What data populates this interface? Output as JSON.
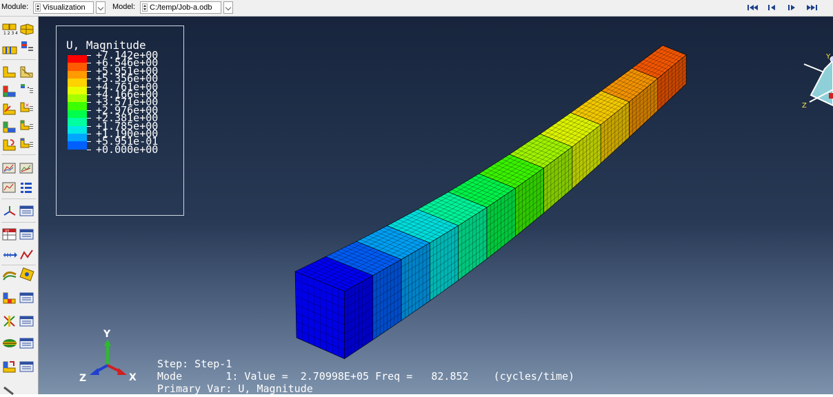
{
  "toolbar": {
    "module_label": "Module:",
    "module_value": "Visualization",
    "model_label": "Model:",
    "model_value": "C:/temp/Job-a.odb",
    "nav_icons": [
      "first-frame-icon",
      "previous-frame-icon",
      "next-frame-icon",
      "last-frame-icon"
    ]
  },
  "toolbox": {
    "icons": [
      "plot-undeformed-shape-icon",
      "plot-deformed-shape-icon",
      "plot-contours-icon",
      "plot-symbols-icon",
      "plot-material-orientations-icon",
      "common-options-icon",
      "animate-scale-factor-icon",
      "animate-harmonic-icon",
      "animate-time-history-icon",
      "animation-options-icon",
      "create-xy-data-icon",
      "xy-data-manager-icon",
      "create-path-icon",
      "plot-xy-icon",
      "report-icon",
      "field-output-icon",
      "view-cut-icon",
      "query-icon",
      "display-group-icon",
      "overlay-plot-icon"
    ]
  },
  "legend": {
    "title": "U, Magnitude",
    "values": [
      "+7.142e+00",
      "+6.546e+00",
      "+5.951e+00",
      "+5.356e+00",
      "+4.761e+00",
      "+4.166e+00",
      "+3.571e+00",
      "+2.976e+00",
      "+2.381e+00",
      "+1.785e+00",
      "+1.190e+00",
      "+5.951e-01",
      "+0.000e+00"
    ],
    "colors": [
      "#ff0000",
      "#ff5a00",
      "#ff9a00",
      "#ffd200",
      "#e8ff00",
      "#a6ff00",
      "#3cff00",
      "#00ff4c",
      "#00ffa0",
      "#00e8e6",
      "#00a6ff",
      "#0060ff",
      "#0000ff"
    ]
  },
  "info": {
    "step": "Step: Step-1",
    "mode": "Mode       1: Value =  2.70998E+05 Freq =   82.852    (cycles/time)",
    "primary_var": "Primary Var: U, Magnitude"
  },
  "triad": {
    "x": "X",
    "y": "Y",
    "z": "Z"
  },
  "view_triad": {
    "y": "Y",
    "z": "Z"
  }
}
